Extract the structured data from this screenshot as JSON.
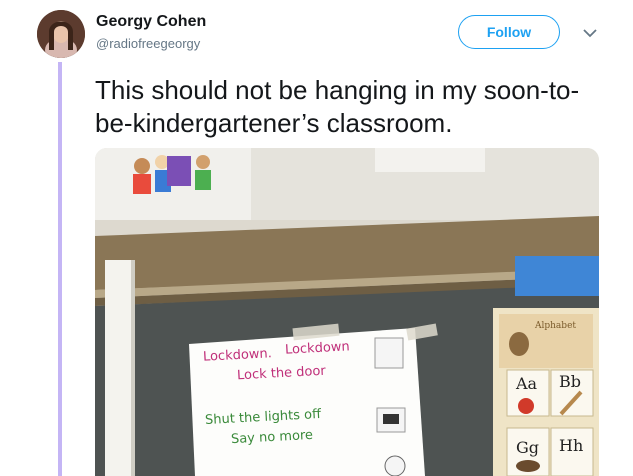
{
  "user": {
    "name": "Georgy Cohen",
    "handle": "@radiofreegeorgy"
  },
  "follow_label": "Follow",
  "tweet_text": "This should not be hanging in my soon-to-be-kindergartener’s classroom.",
  "photo": {
    "poster": {
      "line1a": "Lockdown.",
      "line1b": "Lockdown",
      "line2": "Lock  the  door",
      "line3": "Shut  the  lights  off",
      "line4": "Say  no  more"
    },
    "alphabet": {
      "title": "Alphabet",
      "cells": [
        "Aa",
        "Bb",
        "Gg",
        "Hh"
      ]
    }
  }
}
